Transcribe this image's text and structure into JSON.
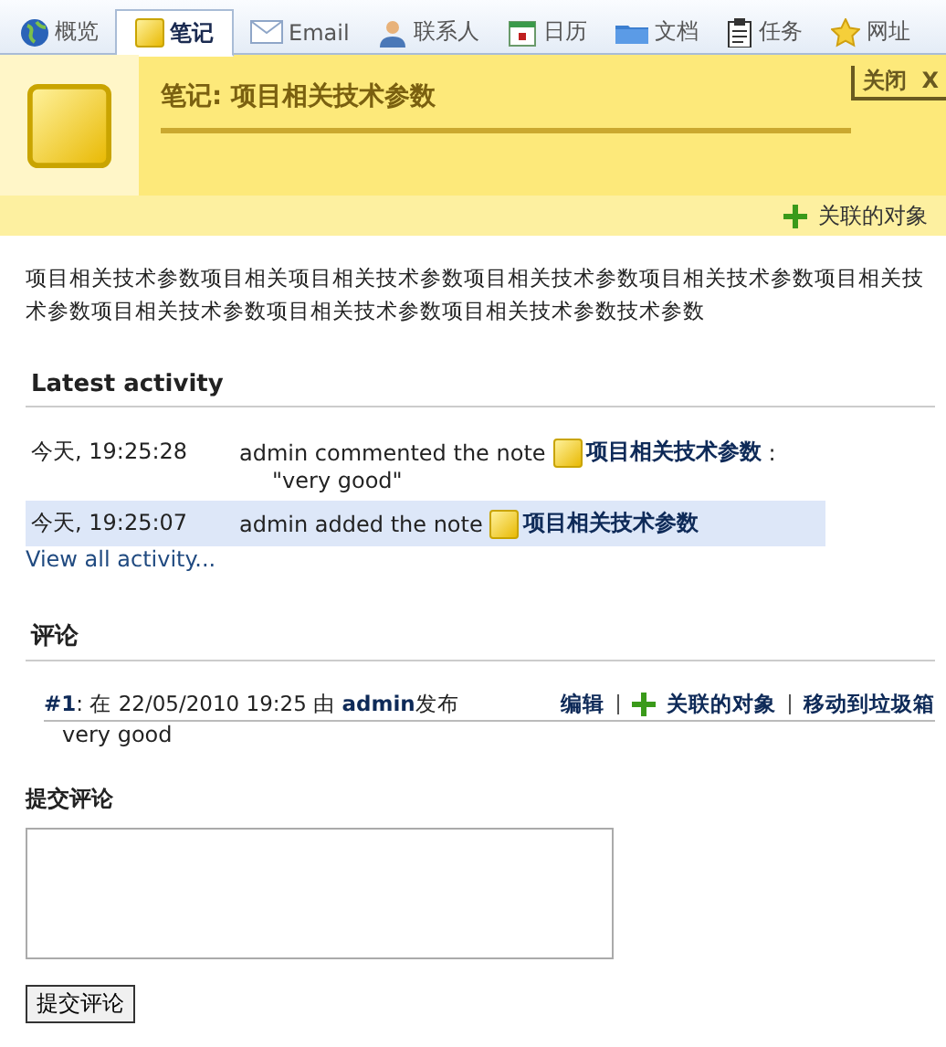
{
  "tabs": [
    {
      "label": "概览",
      "selected": false
    },
    {
      "label": "笔记",
      "selected": true
    },
    {
      "label": "Email",
      "selected": false
    },
    {
      "label": "联系人",
      "selected": false
    },
    {
      "label": "日历",
      "selected": false
    },
    {
      "label": "文档",
      "selected": false
    },
    {
      "label": "任务",
      "selected": false
    },
    {
      "label": "网址",
      "selected": false
    }
  ],
  "note": {
    "title": "笔记: 项目相关技术参数",
    "close": "关闭",
    "close_x": "X",
    "linked_objects": "关联的对象",
    "body": "项目相关技术参数项目相关项目相关技术参数项目相关技术参数项目相关技术参数项目相关技术参数项目相关技术参数项目相关技术参数项目相关技术参数技术参数"
  },
  "activity": {
    "heading": "Latest activity",
    "rows": [
      {
        "time": "今天, 19:25:28",
        "text": "admin commented the note",
        "link": "项目相关技术参数",
        "suffix": ":",
        "quote": "\"very good\"",
        "selected": false
      },
      {
        "time": "今天, 19:25:07",
        "text": "admin added the note",
        "link": "项目相关技术参数",
        "selected": true
      }
    ],
    "view_all": "View all activity..."
  },
  "comments": {
    "heading": "评论",
    "items": [
      {
        "meta": "**#1**: 在 22/05/2010 19:25 由 **admin**发布",
        "edit": "编辑",
        "linked": "关联的对象",
        "trash": "移动到垃圾箱",
        "body": "very good"
      }
    ]
  },
  "submit": {
    "heading": "提交评论",
    "button": "提交评论"
  }
}
